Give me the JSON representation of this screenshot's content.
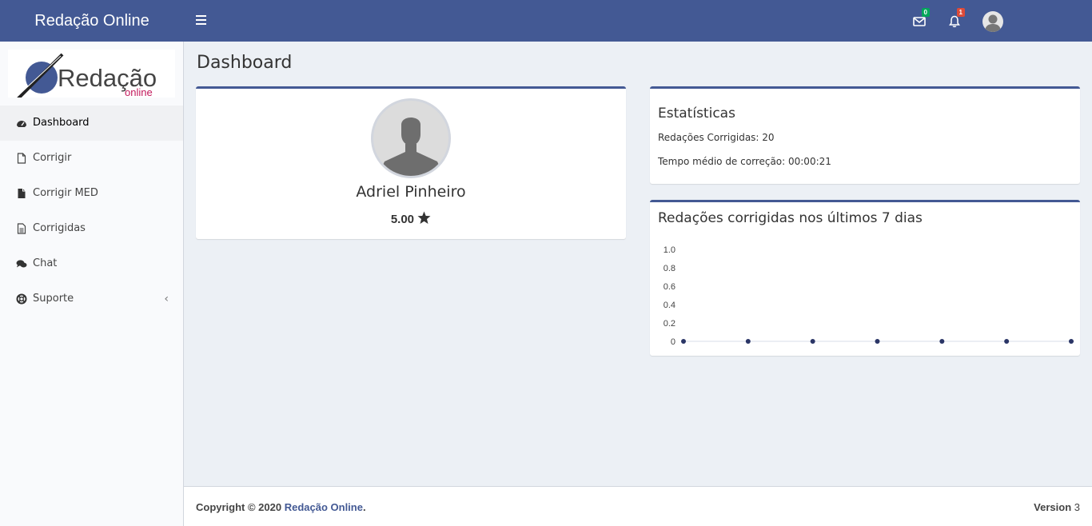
{
  "header": {
    "brand": "Redação Online",
    "messages_count": "0",
    "notifications_count": "1",
    "colors": {
      "primary": "#435994",
      "badge_green": "#00a65a",
      "badge_red": "#dd4b39"
    }
  },
  "sidebar": {
    "logo": {
      "word": "Redação",
      "sub": "online"
    },
    "items": [
      {
        "label": "Dashboard",
        "icon": "dashboard-icon",
        "active": true
      },
      {
        "label": "Corrigir",
        "icon": "file-outline-icon"
      },
      {
        "label": "Corrigir MED",
        "icon": "file-filled-icon"
      },
      {
        "label": "Corrigidas",
        "icon": "file-text-icon"
      },
      {
        "label": "Chat",
        "icon": "comments-icon"
      },
      {
        "label": "Suporte",
        "icon": "life-ring-icon",
        "chevron": "‹"
      }
    ]
  },
  "main": {
    "page_title": "Dashboard",
    "profile": {
      "name": "Adriel Pinheiro",
      "rating": "5.00"
    },
    "stats": {
      "title": "Estatísticas",
      "corrected_label": "Redações Corrigidas: 20",
      "avg_time_label": "Tempo médio de correção: 00:00:21"
    },
    "chart_box": {
      "title": "Redações corrigidas nos últimos 7 dias"
    }
  },
  "chart_data": {
    "type": "line",
    "title": "Redações corrigidas nos últimos 7 dias",
    "x": [
      "",
      "",
      "",
      "",
      "",
      "",
      ""
    ],
    "series": [
      {
        "values": [
          0,
          0,
          0,
          0,
          0,
          0,
          0
        ],
        "color": "#2a3566"
      }
    ],
    "ylim": [
      0,
      1.0
    ],
    "yticks": [
      "1.0",
      "0.8",
      "0.6",
      "0.4",
      "0.2",
      "0"
    ],
    "grid": false
  },
  "footer": {
    "copyright_prefix": "Copyright © 2020 ",
    "copyright_link": "Redação Online",
    "copyright_suffix": ".",
    "version_label": "Version",
    "version_value": "3"
  }
}
